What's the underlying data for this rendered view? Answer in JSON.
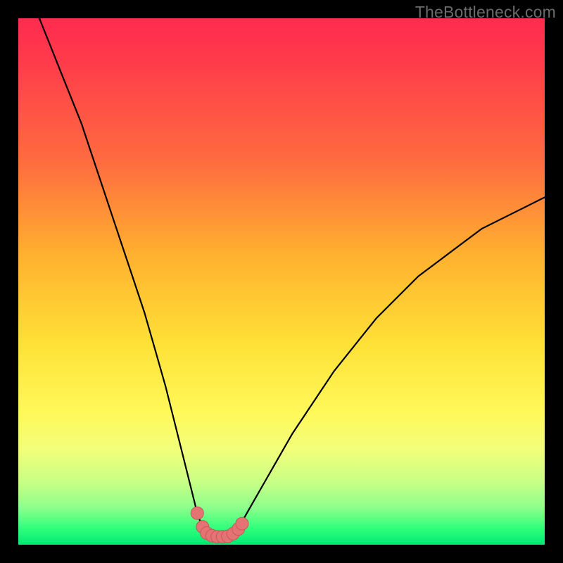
{
  "watermark": "TheBottleneck.com",
  "colors": {
    "page_bg": "#000000",
    "gradient_top": "#ff2b4e",
    "gradient_bottom": "#00e874",
    "curve_stroke": "#000000",
    "marker_fill": "#e57373",
    "marker_stroke": "#c05a5a"
  },
  "chart_data": {
    "type": "line",
    "title": "",
    "xlabel": "",
    "ylabel": "",
    "xlim": [
      0,
      100
    ],
    "ylim": [
      0,
      100
    ],
    "grid": false,
    "legend": false,
    "series": [
      {
        "name": "bottleneck-curve",
        "x": [
          4,
          6,
          8,
          10,
          12,
          14,
          16,
          18,
          20,
          22,
          24,
          26,
          28,
          30,
          32,
          34,
          35,
          36,
          37,
          38,
          39,
          40,
          41,
          42,
          44,
          48,
          52,
          56,
          60,
          64,
          68,
          72,
          76,
          80,
          84,
          88,
          92,
          96,
          100
        ],
        "values": [
          100,
          95,
          90,
          85,
          80,
          74,
          68,
          62,
          56,
          50,
          44,
          37,
          30,
          22,
          14,
          6,
          3.2,
          2.0,
          1.6,
          1.5,
          1.5,
          1.6,
          2.2,
          3.5,
          7,
          14,
          21,
          27,
          33,
          38,
          43,
          47,
          51,
          54,
          57,
          60,
          62,
          64,
          66
        ]
      }
    ],
    "markers": {
      "name": "highlight-points",
      "x": [
        34.0,
        35.0,
        35.8,
        36.8,
        37.8,
        38.8,
        39.8,
        40.8,
        41.8,
        42.5
      ],
      "values": [
        6.0,
        3.4,
        2.2,
        1.7,
        1.5,
        1.5,
        1.6,
        2.1,
        3.0,
        4.0
      ]
    }
  }
}
